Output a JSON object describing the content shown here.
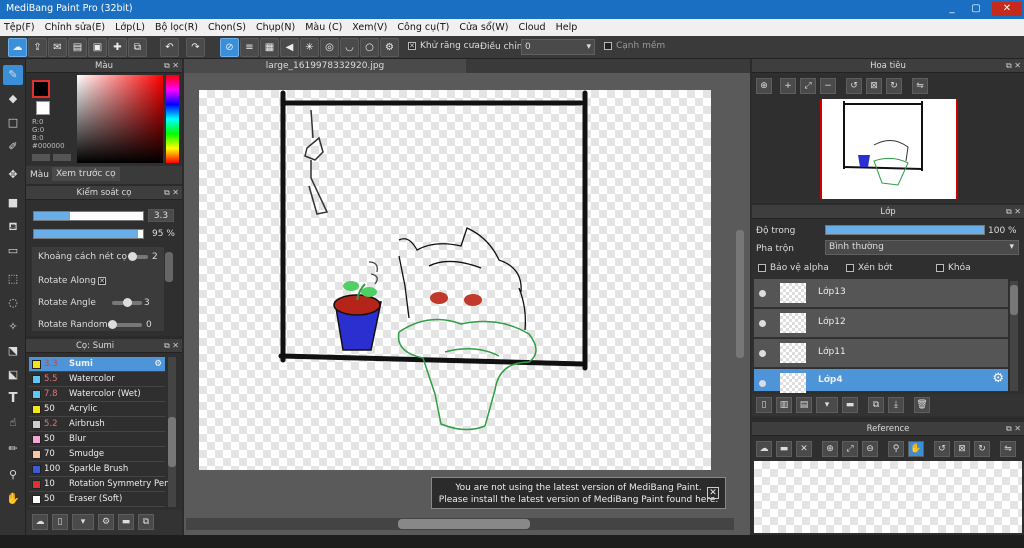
{
  "window": {
    "title": "MediBang Paint Pro (32bit)",
    "minimize": "_",
    "maximize": "▢",
    "close": "✕"
  },
  "menu": [
    "Tệp(F)",
    "Chỉnh sửa(E)",
    "Lớp(L)",
    "Bộ lọc(R)",
    "Chọn(S)",
    "Chụp(N)",
    "Màu (C)",
    "Xem(V)",
    "Công cụ(T)",
    "Cửa sổ(W)",
    "Cloud",
    "Help"
  ],
  "toolbar": {
    "antialias_label": "Khử răng cưa",
    "antialias_checked": true,
    "correction_label": "Điều chỉnh",
    "correction_value": "0",
    "snap_label": "Cạnh mềm",
    "snap_checked": false
  },
  "color_panel": {
    "title": "Màu",
    "r": "R:0",
    "g": "G:0",
    "b": "B:0",
    "hex": "#000000",
    "tab_color": "Màu",
    "tab_preview": "Xem trước cọ"
  },
  "brush_control": {
    "title": "Kiểm soát cọ",
    "size_value": "3.3",
    "size_fraction": 0.33,
    "opacity_value": "95 %",
    "opacity_fraction": 0.95,
    "rows": [
      {
        "label": "Khoảng cách nét cọ",
        "value": "2",
        "fraction": 0.1
      },
      {
        "label": "Rotate Along",
        "value": "",
        "checked": true
      },
      {
        "label": "Rotate Angle",
        "value": "3",
        "fraction": 0.5
      },
      {
        "label": "Rotate Random",
        "value": "0",
        "fraction": 0.1
      }
    ]
  },
  "brush_list": {
    "title": "Cọ: Sumi",
    "items": [
      {
        "size": "3.3",
        "name": "Sumi",
        "color": "#f5e51b",
        "size_color": "#e53935",
        "selected": true
      },
      {
        "size": "5.5",
        "name": "Watercolor",
        "color": "#5bc8f5",
        "size_color": "#e57373",
        "selected": false
      },
      {
        "size": "7.8",
        "name": "Watercolor (Wet)",
        "color": "#5bc8f5",
        "size_color": "#e57373",
        "selected": false
      },
      {
        "size": "50",
        "name": "Acrylic",
        "color": "#f5e51b",
        "size_color": "#eeeeee",
        "selected": false
      },
      {
        "size": "5.2",
        "name": "Airbrush",
        "color": "#cccccc",
        "size_color": "#e57373",
        "selected": false
      },
      {
        "size": "50",
        "name": "Blur",
        "color": "#f5a8d8",
        "size_color": "#eeeeee",
        "selected": false
      },
      {
        "size": "70",
        "name": "Smudge",
        "color": "#f5c8a8",
        "size_color": "#eeeeee",
        "selected": false
      },
      {
        "size": "100",
        "name": "Sparkle Brush",
        "color": "#3b5bdb",
        "size_color": "#eeeeee",
        "selected": false
      },
      {
        "size": "10",
        "name": "Rotation Symmetry Pen",
        "color": "#e03131",
        "size_color": "#eeeeee",
        "selected": false
      },
      {
        "size": "50",
        "name": "Eraser (Soft)",
        "color": "#ffffff",
        "size_color": "#eeeeee",
        "selected": false
      }
    ]
  },
  "canvas": {
    "tab_title": "large_1619978332920.jpg"
  },
  "notification": {
    "line1": "You are not using the latest version of MediBang Paint.",
    "line2": "Please install the latest version of MediBang Paint found here.",
    "close": "✕"
  },
  "navigator": {
    "title": "Hoa tiêu"
  },
  "layer_panel": {
    "title": "Lớp",
    "opacity_label": "Độ trong",
    "opacity_value": "100 %",
    "opacity_fraction": 1.0,
    "blend_label": "Pha trộn",
    "blend_value": "Bình thường",
    "protect_alpha": "Bảo vệ alpha",
    "clipping": "Xén bớt",
    "lock": "Khóa",
    "layers": [
      {
        "name": "Lớp13",
        "selected": false
      },
      {
        "name": "Lớp12",
        "selected": false
      },
      {
        "name": "Lớp11",
        "selected": false
      },
      {
        "name": "Lớp4",
        "selected": true
      }
    ]
  },
  "reference": {
    "title": "Reference"
  }
}
